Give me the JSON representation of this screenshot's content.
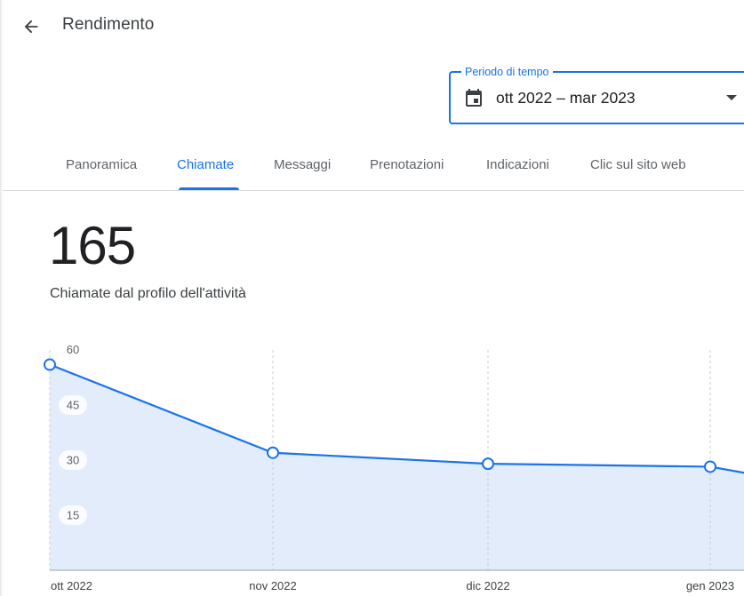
{
  "header": {
    "title": "Rendimento",
    "back_icon": "arrow-back-icon"
  },
  "period": {
    "label": "Periodo di tempo",
    "value": "ott 2022 – mar 2023",
    "icon": "calendar-icon",
    "dropdown_icon": "dropdown-arrow-icon"
  },
  "tabs": [
    {
      "label": "Panoramica",
      "active": false
    },
    {
      "label": "Chiamate",
      "active": true
    },
    {
      "label": "Messaggi",
      "active": false
    },
    {
      "label": "Prenotazioni",
      "active": false
    },
    {
      "label": "Indicazioni",
      "active": false
    },
    {
      "label": "Clic sul sito web",
      "active": false
    }
  ],
  "summary": {
    "total": "165",
    "caption": "Chiamate dal profilo dell'attività"
  },
  "colors": {
    "accent": "#1a73e8",
    "area_fill": "#e3ecfb",
    "text_secondary": "#5f6368"
  },
  "chart_data": {
    "type": "area",
    "x": [
      "ott 2022",
      "nov 2022",
      "dic 2022",
      "gen 2023"
    ],
    "values": [
      56,
      32,
      29,
      28.2
    ],
    "continues_after_last": 26,
    "yticks": [
      15,
      30,
      45,
      60
    ],
    "ylim": [
      0,
      60
    ],
    "grid": "vertical dashed",
    "legend": "none"
  }
}
